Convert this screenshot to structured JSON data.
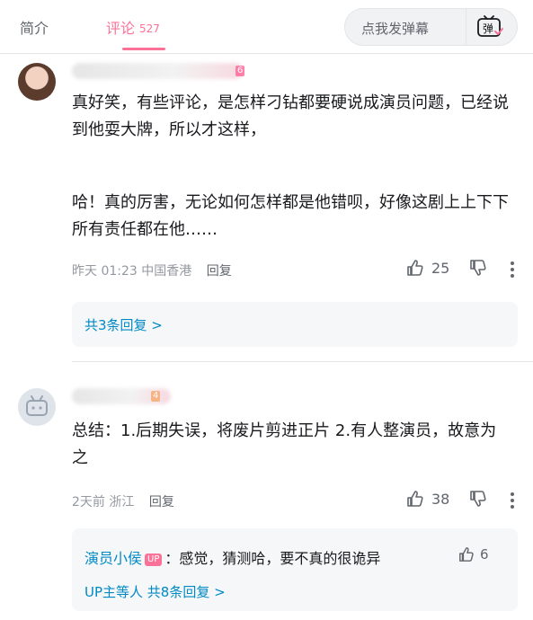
{
  "tabs": {
    "intro": "简介",
    "comments": "评论",
    "comment_count": "527"
  },
  "danmaku": {
    "placeholder": "点我发弹幕",
    "icon_label": "弹"
  },
  "comments": [
    {
      "level": "6",
      "paragraphs": [
        "真好笑，有些评论，是怎样刁钻都要硬说成演员问题，已经说到他耍大牌，所以才这样，",
        "哈！真的厉害，无论如何怎样都是他错呗，好像这剧上上下下所有责任都在他……"
      ],
      "time": "昨天 01:23",
      "location": "中国香港",
      "reply_label": "回复",
      "likes": "25",
      "replies_link": "共3条回复 >"
    },
    {
      "level": "4",
      "paragraphs": [
        "总结：1.后期失误，将废片剪进正片 2.有人整演员，故意为之"
      ],
      "time": "2天前",
      "location": "浙江",
      "reply_label": "回复",
      "likes": "38",
      "sub_reply": {
        "author": "演员小侯",
        "badge": "UP",
        "text": "：感觉，猜测哈，要不真的很诡异",
        "likes": "6"
      },
      "replies_link": "UP主等人 共8条回复 >"
    }
  ],
  "colors": {
    "accent": "#fb7299",
    "link": "#008ac5",
    "meta": "#9499a0"
  }
}
